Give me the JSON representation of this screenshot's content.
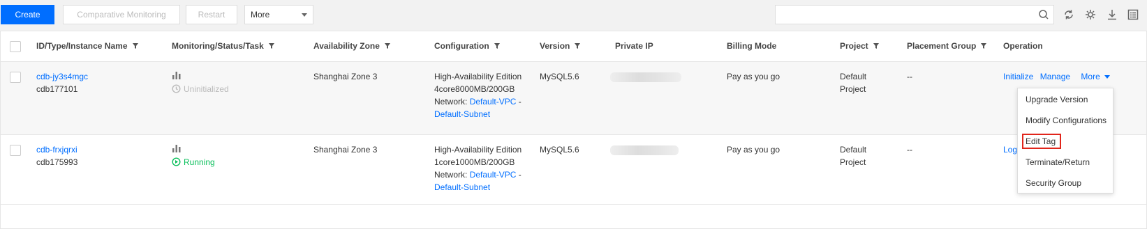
{
  "toolbar": {
    "create_label": "Create",
    "comparative_label": "Comparative Monitoring",
    "restart_label": "Restart",
    "more_select_value": "More",
    "search_placeholder": ""
  },
  "table": {
    "columns": [
      "ID/Type/Instance Name",
      "Monitoring/Status/Task",
      "Availability Zone",
      "Configuration",
      "Version",
      "Private IP",
      "Billing Mode",
      "Project",
      "Placement Group",
      "Operation"
    ],
    "rows": [
      {
        "id": "cdb-jy3s4mgc",
        "name": "cdb177101",
        "status": "Uninitialized",
        "zone": "Shanghai Zone 3",
        "config_line1": "High-Availability Edition",
        "config_line2": "4core8000MB/200GB",
        "network_label": "Network:",
        "network_vpc": "Default-VPC",
        "network_sep": "-",
        "network_subnet": "Default-Subnet",
        "version": "MySQL5.6",
        "billing": "Pay as you go",
        "project_line1": "Default",
        "project_line2": "Project",
        "placement": "--",
        "op_initialize": "Initialize",
        "op_manage": "Manage",
        "op_more": "More"
      },
      {
        "id": "cdb-frxjqrxi",
        "name": "cdb175993",
        "status": "Running",
        "zone": "Shanghai Zone 3",
        "config_line1": "High-Availability Edition",
        "config_line2": "1core1000MB/200GB",
        "network_label": "Network:",
        "network_vpc": "Default-VPC",
        "network_sep": "-",
        "network_subnet": "Default-Subnet",
        "version": "MySQL5.6",
        "billing": "Pay as you go",
        "project_line1": "Default",
        "project_line2": "Project",
        "placement": "--",
        "op_login": "Logi"
      }
    ]
  },
  "more_menu": {
    "items": [
      "Upgrade Version",
      "Modify Configurations",
      "Edit Tag",
      "Terminate/Return",
      "Security Group"
    ]
  },
  "colors": {
    "accent": "#006eff",
    "running": "#0abf5b",
    "highlight": "#e1251b"
  }
}
